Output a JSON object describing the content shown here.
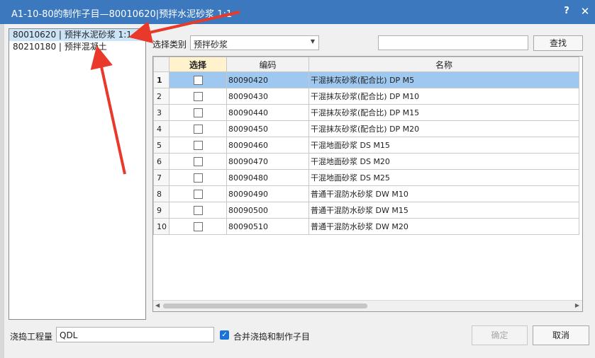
{
  "window": {
    "title": "A1-10-80的制作子目—80010620|预拌水泥砂浆 1:1",
    "help_icon": "?",
    "close_icon": "✕"
  },
  "tree": {
    "items": [
      {
        "label": "80010620 | 预拌水泥砂浆 1:1",
        "selected": true
      },
      {
        "label": "80210180 | 预拌混凝土",
        "selected": false
      }
    ]
  },
  "filter": {
    "category_label": "选择类别",
    "category_value": "预拌砂浆",
    "search_value": "",
    "search_button": "查找"
  },
  "grid": {
    "columns": [
      "选择",
      "编码",
      "名称"
    ],
    "rows": [
      {
        "num": "1",
        "checked": false,
        "code": "80090420",
        "name": "干混抹灰砂浆(配合比) DP M5"
      },
      {
        "num": "2",
        "checked": false,
        "code": "80090430",
        "name": "干混抹灰砂浆(配合比) DP M10"
      },
      {
        "num": "3",
        "checked": false,
        "code": "80090440",
        "name": "干混抹灰砂浆(配合比) DP M15"
      },
      {
        "num": "4",
        "checked": false,
        "code": "80090450",
        "name": "干混抹灰砂浆(配合比) DP M20"
      },
      {
        "num": "5",
        "checked": false,
        "code": "80090460",
        "name": "干混地面砂浆 DS M15"
      },
      {
        "num": "6",
        "checked": false,
        "code": "80090470",
        "name": "干混地面砂浆 DS M20"
      },
      {
        "num": "7",
        "checked": false,
        "code": "80090480",
        "name": "干混地面砂浆 DS M25"
      },
      {
        "num": "8",
        "checked": false,
        "code": "80090490",
        "name": "普通干混防水砂浆 DW M10"
      },
      {
        "num": "9",
        "checked": false,
        "code": "80090500",
        "name": "普通干混防水砂浆 DW M15"
      },
      {
        "num": "10",
        "checked": false,
        "code": "80090510",
        "name": "普通干混防水砂浆 DW M20"
      }
    ]
  },
  "footer": {
    "qty_label": "浇捣工程量",
    "qty_value": "QDL",
    "merge_label": "合并浇捣和制作子目",
    "merge_checked": true,
    "ok_button": "确定",
    "cancel_button": "取消"
  },
  "colors": {
    "titlebar": "#3c78bd",
    "selected_row": "#9ec8f0",
    "annotation_arrow": "#e8392a"
  }
}
